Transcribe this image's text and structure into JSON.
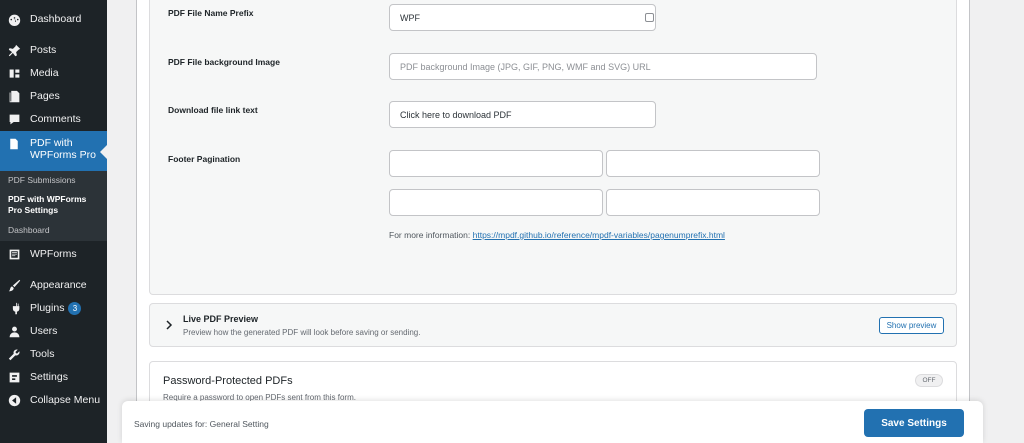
{
  "sidebar": {
    "menu": [
      {
        "label": "Dashboard",
        "icon": "dashboard-icon"
      },
      {
        "label": "Posts",
        "icon": "pin-icon"
      },
      {
        "label": "Media",
        "icon": "media-icon"
      },
      {
        "label": "Pages",
        "icon": "pages-icon"
      },
      {
        "label": "Comments",
        "icon": "comments-icon"
      }
    ],
    "active": {
      "label_line1": "PDF with",
      "label_line2": "WPForms Pro",
      "icon": "document-icon"
    },
    "submenu": {
      "pdf_submissions": "PDF Submissions",
      "settings_line1": "PDF with WPForms",
      "settings_line2": "Pro Settings",
      "dashboard": "Dashboard"
    },
    "menu2": [
      {
        "label": "WPForms",
        "icon": "wpforms-icon"
      },
      {
        "label": "Appearance",
        "icon": "brush-icon"
      },
      {
        "label": "Plugins",
        "icon": "plugin-icon",
        "badge": "3"
      },
      {
        "label": "Users",
        "icon": "user-icon"
      },
      {
        "label": "Tools",
        "icon": "wrench-icon"
      },
      {
        "label": "Settings",
        "icon": "settings-icon"
      },
      {
        "label": "Collapse Menu",
        "icon": "collapse-icon"
      }
    ]
  },
  "form": {
    "prefix_label": "PDF File Name Prefix",
    "prefix_value": "WPF",
    "bg_label": "PDF File background Image",
    "bg_placeholder": "PDF background Image (JPG, GIF, PNG, WMF and SVG) URL",
    "link_label": "Download file link text",
    "link_value": "Click here to download PDF",
    "pagination_label": "Footer Pagination",
    "info_prefix": "For more information: ",
    "info_link": "https://mpdf.github.io/reference/mpdf-variables/pagenumprefix.html"
  },
  "live_preview": {
    "title": "Live PDF Preview",
    "subtitle": "Preview how the generated PDF will look before saving or sending.",
    "button": "Show preview"
  },
  "password": {
    "title": "Password-Protected PDFs",
    "subtitle": "Require a password to open PDFs sent from this form.",
    "toggle": "OFF"
  },
  "footer": {
    "status": "Saving updates for: General Setting",
    "save": "Save Settings"
  },
  "colors": {
    "accent": "#2271b1",
    "sidebar": "#1d2327"
  }
}
